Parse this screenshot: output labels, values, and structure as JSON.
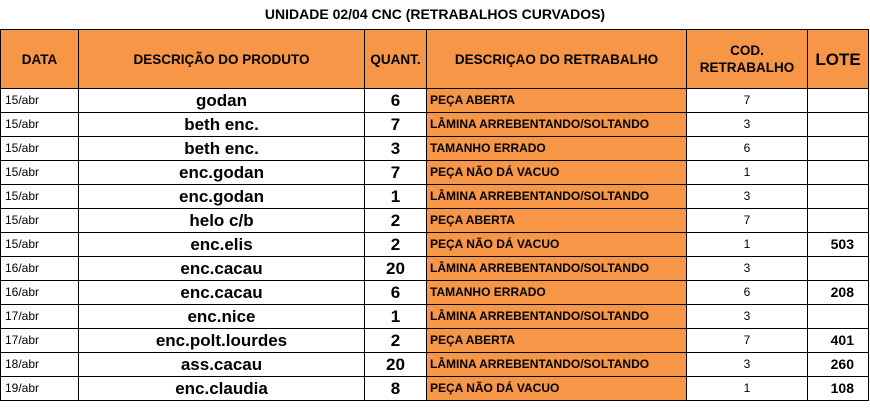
{
  "title": "UNIDADE 02/04 CNC (RETRABALHOS CURVADOS)",
  "headers": {
    "data": "DATA",
    "produto": "DESCRIÇÃO DO PRODUTO",
    "quant": "QUANT.",
    "retrabalho": "DESCRIÇAO DO RETRABALHO",
    "cod_line1": "COD.",
    "cod_line2": "RETRABALHO",
    "lote": "LOTE"
  },
  "rows": [
    {
      "data": "15/abr",
      "produto": "godan",
      "quant": "6",
      "retrabalho": "PEÇA ABERTA",
      "cod": "7",
      "lote": ""
    },
    {
      "data": "15/abr",
      "produto": "beth enc.",
      "quant": "7",
      "retrabalho": "LÂMINA ARREBENTANDO/SOLTANDO",
      "cod": "3",
      "lote": ""
    },
    {
      "data": "15/abr",
      "produto": "beth enc.",
      "quant": "3",
      "retrabalho": "TAMANHO ERRADO",
      "cod": "6",
      "lote": ""
    },
    {
      "data": "15/abr",
      "produto": "enc.godan",
      "quant": "7",
      "retrabalho": "PEÇA NÃO DÁ VACUO",
      "cod": "1",
      "lote": ""
    },
    {
      "data": "15/abr",
      "produto": "enc.godan",
      "quant": "1",
      "retrabalho": "LÂMINA ARREBENTANDO/SOLTANDO",
      "cod": "3",
      "lote": ""
    },
    {
      "data": "15/abr",
      "produto": "helo c/b",
      "quant": "2",
      "retrabalho": "PEÇA ABERTA",
      "cod": "7",
      "lote": ""
    },
    {
      "data": "15/abr",
      "produto": "enc.elis",
      "quant": "2",
      "retrabalho": "PEÇA NÃO DÁ VACUO",
      "cod": "1",
      "lote": "503"
    },
    {
      "data": "16/abr",
      "produto": "enc.cacau",
      "quant": "20",
      "retrabalho": "LÂMINA ARREBENTANDO/SOLTANDO",
      "cod": "3",
      "lote": ""
    },
    {
      "data": "16/abr",
      "produto": "enc.cacau",
      "quant": "6",
      "retrabalho": "TAMANHO ERRADO",
      "cod": "6",
      "lote": "208"
    },
    {
      "data": "17/abr",
      "produto": "enc.nice",
      "quant": "1",
      "retrabalho": "LÂMINA ARREBENTANDO/SOLTANDO",
      "cod": "3",
      "lote": ""
    },
    {
      "data": "17/abr",
      "produto": "enc.polt.lourdes",
      "quant": "2",
      "retrabalho": "PEÇA ABERTA",
      "cod": "7",
      "lote": "401"
    },
    {
      "data": "18/abr",
      "produto": "ass.cacau",
      "quant": "20",
      "retrabalho": "LÂMINA ARREBENTANDO/SOLTANDO",
      "cod": "3",
      "lote": "260"
    },
    {
      "data": "19/abr",
      "produto": "enc.claudia",
      "quant": "8",
      "retrabalho": "PEÇA NÃO DÁ VACUO",
      "cod": "1",
      "lote": "108"
    }
  ],
  "colors": {
    "header_bg": "#f79646",
    "desc_bg": "#f79646",
    "border": "#000000"
  }
}
